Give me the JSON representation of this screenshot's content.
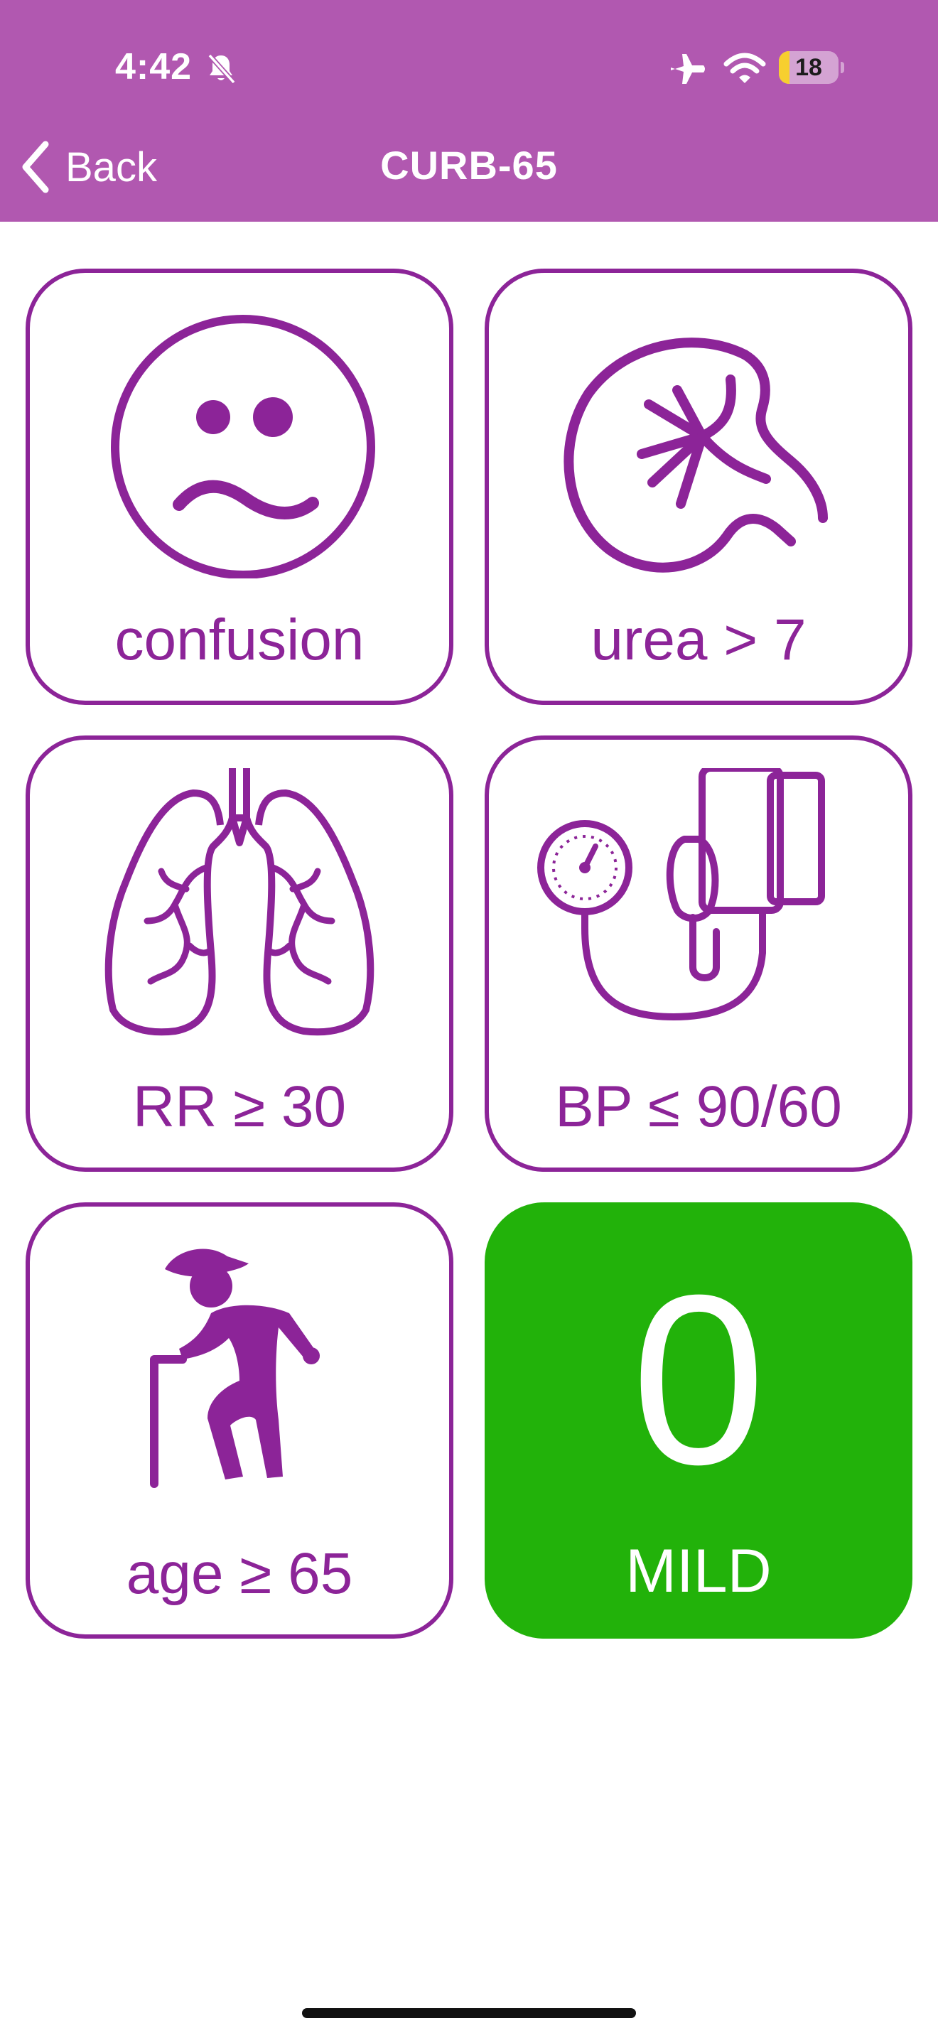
{
  "status_bar": {
    "time": "4:42",
    "battery_level": "18",
    "battery_fraction": 0.18,
    "icons": [
      "bell-slash-icon",
      "airplane-icon",
      "wifi-icon",
      "battery-icon"
    ]
  },
  "nav": {
    "back_label": "Back",
    "title": "CURB-65"
  },
  "criteria": [
    {
      "label": "confusion",
      "icon": "confused-face-icon"
    },
    {
      "label": "urea > 7",
      "icon": "kidney-icon"
    },
    {
      "label": "RR ≥ 30",
      "icon": "lungs-icon"
    },
    {
      "label": "BP ≤ 90/60",
      "icon": "blood-pressure-cuff-icon"
    },
    {
      "label": "age ≥ 65",
      "icon": "elderly-person-with-cane-icon"
    }
  ],
  "score": {
    "value": "0",
    "severity": "MILD"
  },
  "colors": {
    "header": "#b158b0",
    "accent": "#8c2498",
    "score_green": "#22b20a",
    "background": "#ffffff"
  }
}
